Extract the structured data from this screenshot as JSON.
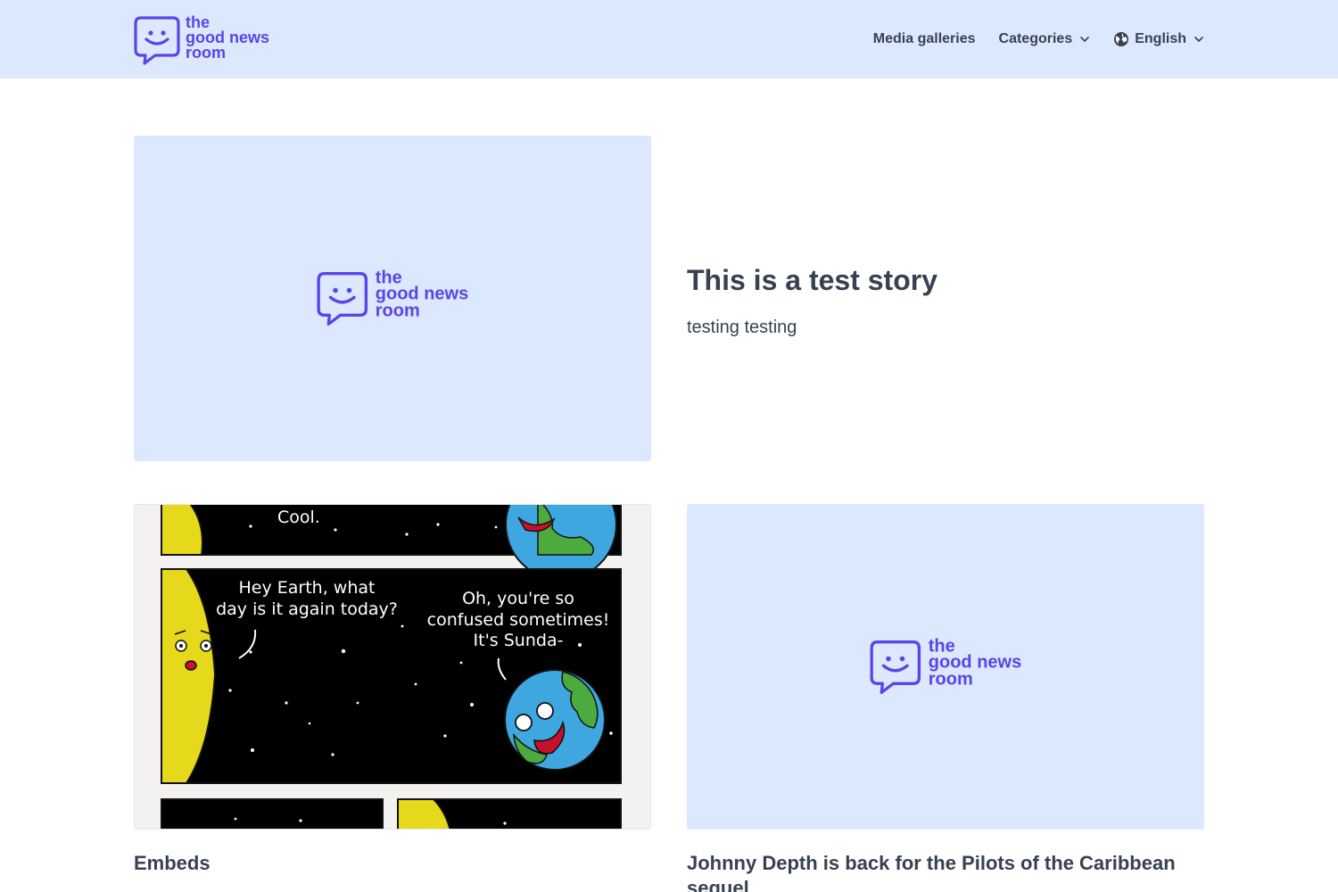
{
  "brand": {
    "line1": "the",
    "line2": "good news",
    "line3": "room",
    "color": "#5b44e8"
  },
  "nav": {
    "media_galleries": "Media galleries",
    "categories": "Categories",
    "language": "English"
  },
  "featured": {
    "title": "This is a test story",
    "subtitle": "testing testing"
  },
  "cards": [
    {
      "title": "Embeds",
      "comic": {
        "top_caption": "Cool.",
        "moon_speech": [
          "Hey Earth, what",
          "day is it again today?"
        ],
        "earth_speech": [
          "Oh, you're so",
          "confused sometimes!",
          "It's Sunda-"
        ]
      }
    },
    {
      "title": "Johnny Depth is back for the Pilots of the Caribbean sequel"
    }
  ],
  "colors": {
    "header_bg": "#dce8fd",
    "placeholder_bg": "#dce8fd",
    "text": "#374151"
  }
}
